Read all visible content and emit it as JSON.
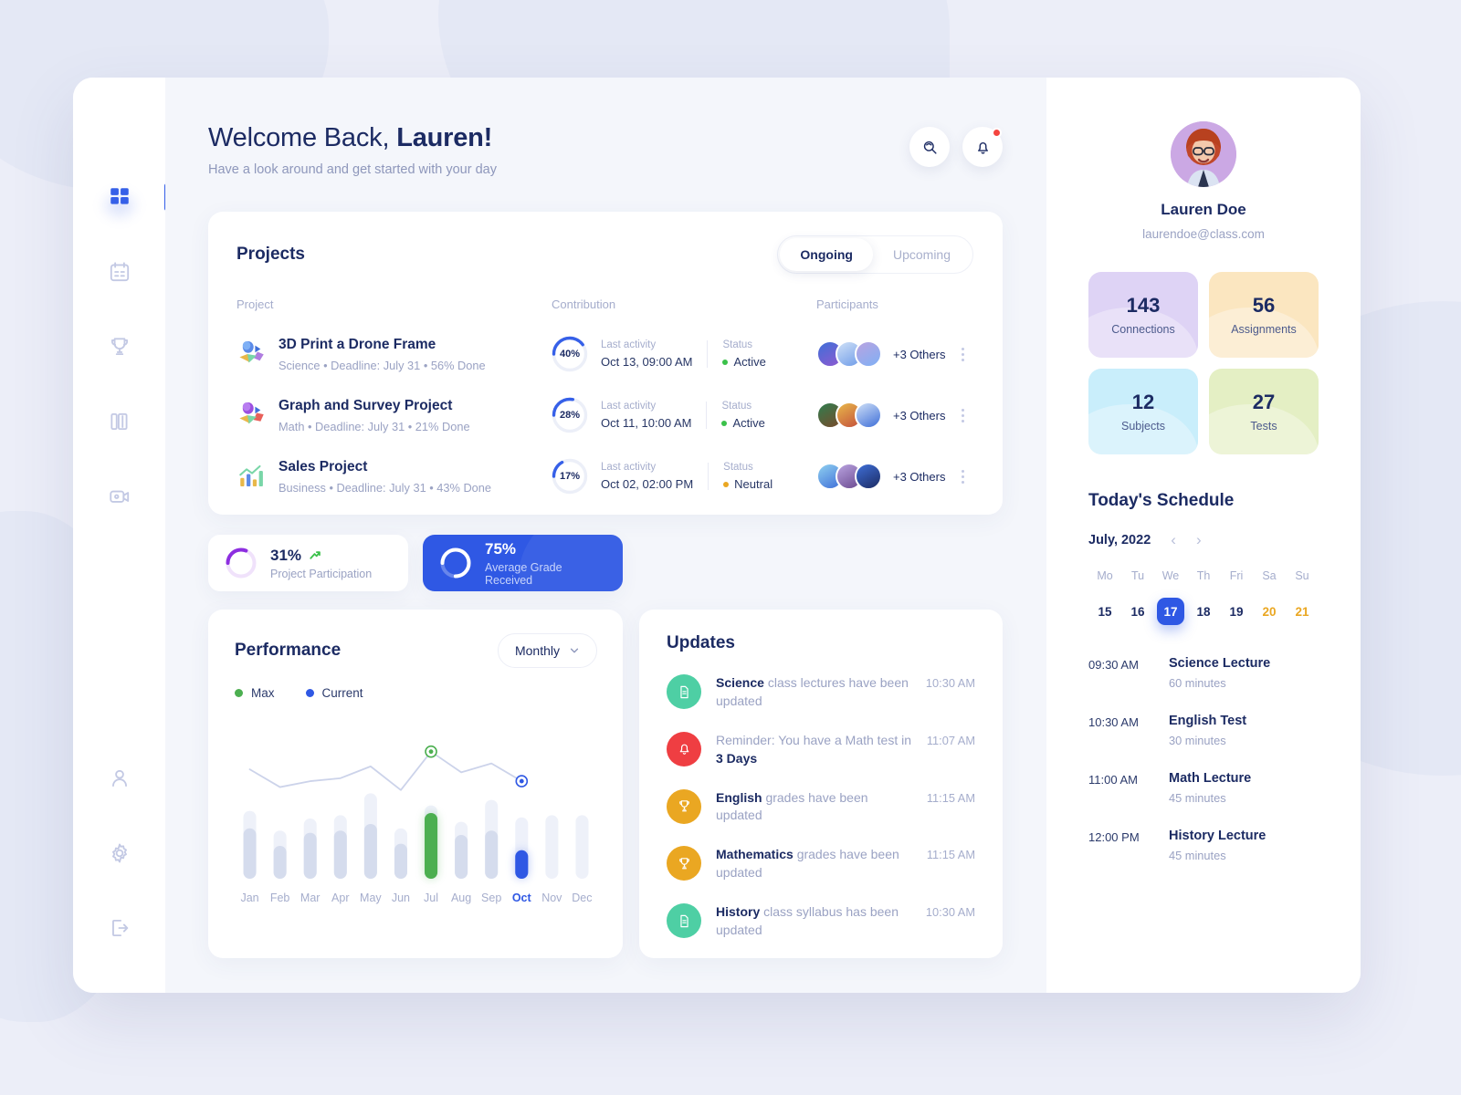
{
  "nav": {
    "top_items": [
      {
        "name": "dashboard",
        "icon": "grid-icon",
        "active": true
      },
      {
        "name": "calendar",
        "icon": "calendar-icon",
        "active": false
      },
      {
        "name": "achievements",
        "icon": "trophy-icon",
        "active": false
      },
      {
        "name": "library",
        "icon": "books-icon",
        "active": false
      },
      {
        "name": "video",
        "icon": "video-camera-icon",
        "active": false
      }
    ],
    "bottom_items": [
      {
        "name": "profile",
        "icon": "user-icon"
      },
      {
        "name": "settings",
        "icon": "gear-icon"
      },
      {
        "name": "logout",
        "icon": "logout-icon"
      }
    ]
  },
  "header": {
    "greeting_prefix": "Welcome Back, ",
    "greeting_name": "Lauren!",
    "subtitle": "Have a look around and get started with your day",
    "search_icon": "search-icon",
    "notification_icon": "bell-icon",
    "has_notification": true
  },
  "projects": {
    "title": "Projects",
    "tabs": [
      {
        "label": "Ongoing",
        "active": true
      },
      {
        "label": "Upcoming",
        "active": false
      }
    ],
    "columns": [
      "Project",
      "Contribution",
      "Participants"
    ],
    "last_activity_label": "Last activity",
    "status_label": "Status",
    "participants_suffix": "+3 Others",
    "rows": [
      {
        "name": "3D Print a Drone Frame",
        "meta": "Science • Deadline: July 31 • 56% Done",
        "contribution": "40%",
        "contribution_value": 40,
        "last_activity": "Oct 13, 09:00 AM",
        "status": "Active",
        "status_color": "#3ac14a",
        "participants": "+3 Others",
        "icon": "shapes-3d-icon"
      },
      {
        "name": "Graph and Survey Project",
        "meta": "Math • Deadline: July 31 • 21% Done",
        "contribution": "28%",
        "contribution_value": 28,
        "last_activity": "Oct 11, 10:00 AM",
        "status": "Active",
        "status_color": "#3ac14a",
        "participants": "+3 Others",
        "icon": "shapes-3d-icon"
      },
      {
        "name": "Sales Project",
        "meta": "Business • Deadline: July 31 • 43% Done",
        "contribution": "17%",
        "contribution_value": 17,
        "last_activity": "Oct 02, 02:00 PM",
        "status": "Neutral",
        "status_color": "#eaa722",
        "participants": "+3 Others",
        "icon": "bar-chart-icon"
      }
    ]
  },
  "mini_stats": [
    {
      "value": "31%",
      "label": "Project Participation",
      "percent": 31,
      "trend": "up",
      "theme": "light",
      "ring_color": "#8d2ee0"
    },
    {
      "value": "75%",
      "label": "Average Grade Received",
      "percent": 75,
      "trend": "none",
      "theme": "blue",
      "ring_color": "#ffffff"
    }
  ],
  "performance": {
    "title": "Performance",
    "range_label": "Monthly",
    "legend": [
      {
        "label": "Max",
        "color": "#4caf50"
      },
      {
        "label": "Current",
        "color": "#2f58e4"
      }
    ]
  },
  "chart_data": {
    "type": "bar",
    "title": "Performance",
    "xlabel": "",
    "ylabel": "",
    "ylim": [
      0,
      100
    ],
    "grid": false,
    "legend_position": "top-left",
    "categories": [
      "Jan",
      "Feb",
      "Mar",
      "Apr",
      "May",
      "Jun",
      "Jul",
      "Aug",
      "Sep",
      "Oct",
      "Nov",
      "Dec"
    ],
    "highlight": {
      "max_month": "Jul",
      "current_month": "Oct"
    },
    "series": [
      {
        "name": "Max",
        "values": [
          62,
          44,
          55,
          58,
          78,
          46,
          67,
          52,
          72,
          56,
          58,
          58
        ]
      },
      {
        "name": "Current",
        "values": [
          46,
          30,
          42,
          44,
          50,
          32,
          60,
          40,
          44,
          26,
          0,
          0
        ]
      },
      {
        "name": "Trend Line",
        "values": [
          74,
          62,
          66,
          68,
          76,
          60,
          86,
          72,
          78,
          66,
          0,
          0
        ]
      }
    ]
  },
  "updates": {
    "title": "Updates",
    "items": [
      {
        "bold": "Science",
        "rest": " class lectures have been updated",
        "time": "10:30 AM",
        "icon": "document-icon",
        "color": "#4ecfa4"
      },
      {
        "bold_lead": "Reminder: You have a Math test in ",
        "bold": "3 Days",
        "rest": "",
        "time": "11:07 AM",
        "icon": "bell-icon",
        "color": "#ef3e42"
      },
      {
        "bold": "English",
        "rest": " grades have been updated",
        "time": "11:15 AM",
        "icon": "trophy-icon",
        "color": "#eaa722"
      },
      {
        "bold": "Mathematics",
        "rest": " grades have been updated",
        "time": "11:15 AM",
        "icon": "trophy-icon",
        "color": "#eaa722"
      },
      {
        "bold": "History",
        "rest": " class syllabus has been updated",
        "time": "10:30 AM",
        "icon": "document-icon",
        "color": "#4ecfa4"
      }
    ]
  },
  "profile": {
    "name": "Lauren Doe",
    "email": "laurendoe@class.com",
    "avatar": "user-avatar"
  },
  "tiles": [
    {
      "value": "143",
      "label": "Connections",
      "color": "#ded3f5"
    },
    {
      "value": "56",
      "label": "Assignments",
      "color": "#fbe6c0"
    },
    {
      "value": "12",
      "label": "Subjects",
      "color": "#c9eefb"
    },
    {
      "value": "27",
      "label": "Tests",
      "color": "#e4efc4"
    }
  ],
  "schedule": {
    "title": "Today's Schedule",
    "month": "July, 2022",
    "prev_icon": "chevron-left-icon",
    "next_icon": "chevron-right-icon",
    "weekdays": [
      "Mo",
      "Tu",
      "We",
      "Th",
      "Fri",
      "Sa",
      "Su"
    ],
    "days": [
      {
        "num": "15",
        "selected": false,
        "weekend": false
      },
      {
        "num": "16",
        "selected": false,
        "weekend": false
      },
      {
        "num": "17",
        "selected": true,
        "weekend": false
      },
      {
        "num": "18",
        "selected": false,
        "weekend": false
      },
      {
        "num": "19",
        "selected": false,
        "weekend": false
      },
      {
        "num": "20",
        "selected": false,
        "weekend": true
      },
      {
        "num": "21",
        "selected": false,
        "weekend": true
      }
    ],
    "events": [
      {
        "time": "09:30 AM",
        "name": "Science Lecture",
        "duration": "60 minutes"
      },
      {
        "time": "10:30 AM",
        "name": "English Test",
        "duration": "30 minutes"
      },
      {
        "time": "11:00 AM",
        "name": "Math Lecture",
        "duration": "45 minutes"
      },
      {
        "time": "12:00 PM",
        "name": "History Lecture",
        "duration": "45 minutes"
      }
    ]
  }
}
